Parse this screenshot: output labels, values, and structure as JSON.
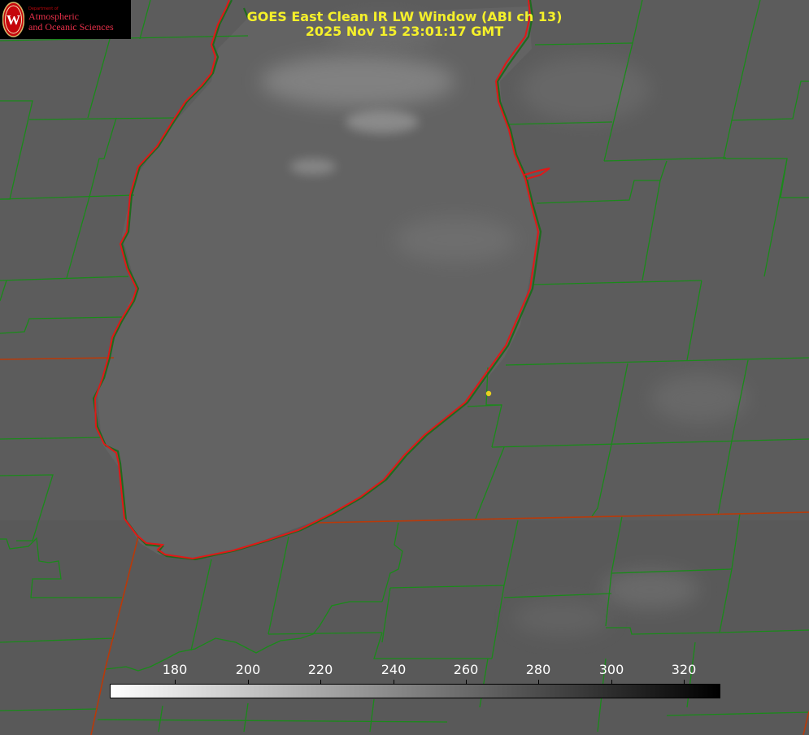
{
  "title": {
    "line1": "GOES East Clean IR LW Window (ABI ch 13)",
    "line2": "2025 Nov 15 23:01:17 GMT"
  },
  "logo": {
    "dept": "Department of",
    "line1": "Atmospheric",
    "line2": "and Oceanic Sciences",
    "seal_letter": "W"
  },
  "colorbar": {
    "min": 162,
    "max": 330,
    "gradient": "white-to-black",
    "ticks": [
      "180",
      "200",
      "220",
      "240",
      "260",
      "280",
      "300",
      "320"
    ]
  },
  "colors": {
    "lake_outline": "#e01818",
    "county_lines": "#1a8a1a",
    "state_lines": "#b83a0a",
    "title_text": "#f5f02a",
    "marker": "#e8d020",
    "background_gray": "#5d5d5d",
    "lake_gray": "#646464",
    "cloud_gray": "#8a8a8a"
  }
}
